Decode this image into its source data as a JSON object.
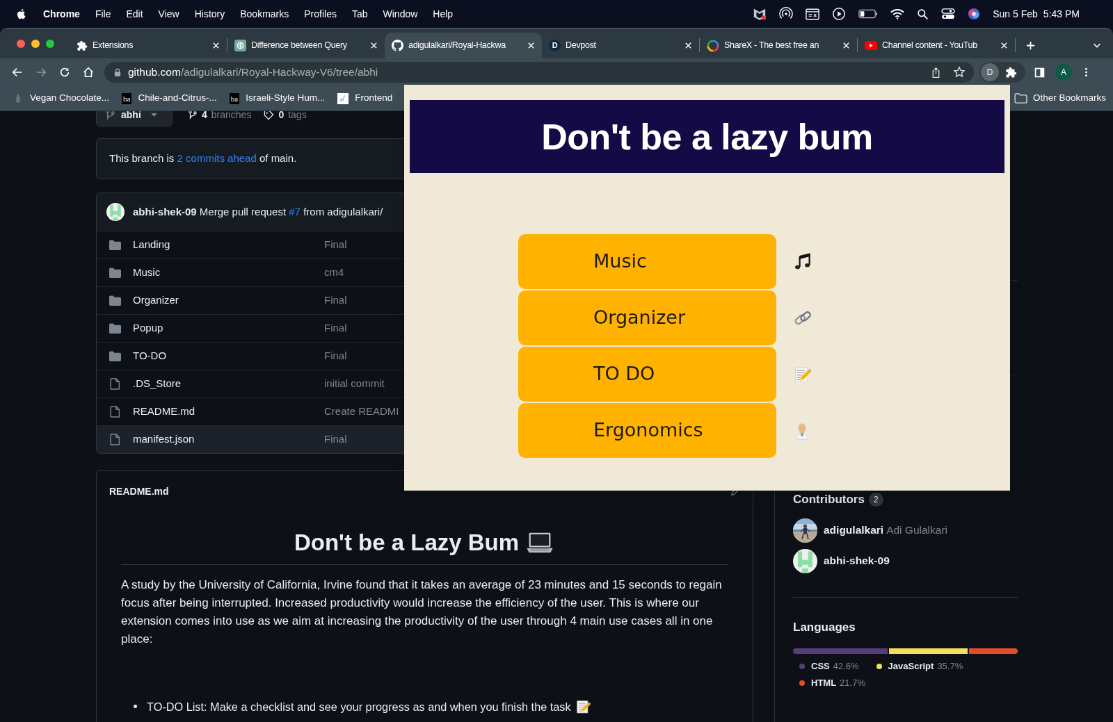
{
  "menu_bar": {
    "app": "Chrome",
    "menus": [
      "File",
      "Edit",
      "View",
      "History",
      "Bookmarks",
      "Profiles",
      "Tab",
      "Window",
      "Help"
    ],
    "date": "Sun 5 Feb",
    "time": "5:43 PM"
  },
  "tabs": [
    {
      "title": "Extensions",
      "kind": "puzzle",
      "selected": false
    },
    {
      "title": "Difference between Query",
      "kind": "openai",
      "selected": false
    },
    {
      "title": "adigulalkari/Royal-Hackwa",
      "kind": "github",
      "selected": true
    },
    {
      "title": "Devpost",
      "kind": "letter",
      "letter": "D",
      "selected": false
    },
    {
      "title": "ShareX - The best free an",
      "kind": "sharex",
      "selected": false
    },
    {
      "title": "Channel content - YouTub",
      "kind": "youtube",
      "selected": false
    }
  ],
  "address_bar": {
    "host": "github.com",
    "path": "/adigulalkari/Royal-Hackway-V6/tree/abhi"
  },
  "toolbar": {
    "profile_letter": "D",
    "account_letter": "A"
  },
  "bookmarks": [
    {
      "label": "Vegan Chocolate...",
      "kind": "bottle"
    },
    {
      "label": "Chile-and-Citrus-...",
      "kind": "text",
      "favicon_text": "ba"
    },
    {
      "label": "Israeli-Style Hum...",
      "kind": "text",
      "favicon_text": "ba"
    },
    {
      "label": "Frontend"
    }
  ],
  "other_bookmarks": "Other Bookmarks",
  "repo": {
    "branch": "abhi",
    "branches_count": "4",
    "branches_label": "branches",
    "tags_count": "0",
    "tags_label": "tags",
    "ahead_notice": {
      "before": "This branch is ",
      "link": "2 commits ahead",
      "after": " of main."
    },
    "latest_commit": {
      "author": "abhi-shek-09",
      "before": "Merge pull request ",
      "link": "#7",
      "after": " from adigulalkari/"
    },
    "files": [
      {
        "name": "Landing",
        "kind": "folder",
        "message": "Final",
        "hovered": false
      },
      {
        "name": "Music",
        "kind": "folder",
        "message": "cm4",
        "hovered": false
      },
      {
        "name": "Organizer",
        "kind": "folder",
        "message": "Final",
        "hovered": false
      },
      {
        "name": "Popup",
        "kind": "folder",
        "message": "Final",
        "hovered": false
      },
      {
        "name": "TO-DO",
        "kind": "folder",
        "message": "Final",
        "hovered": false
      },
      {
        "name": ".DS_Store",
        "kind": "file",
        "message": "initial commit",
        "hovered": false
      },
      {
        "name": "README.md",
        "kind": "file",
        "message": "Create READMI",
        "hovered": false
      },
      {
        "name": "manifest.json",
        "kind": "file",
        "message": "Final",
        "hovered": true
      }
    ],
    "readme": {
      "filename": "README.md",
      "heading": "Don't be a Lazy Bum",
      "paragraph": "A study by the University of California, Irvine found that it takes an average of 23 minutes and 15 seconds to regain focus after being interrupted. Increased productivity would increase the efficiency of the user. This is where our extension comes into use as we aim at increasing the productivity of the user through 4 main use cases all in one place:",
      "list": [
        "TO-DO List: Make a checklist and see your progress as and when you finish the task"
      ]
    }
  },
  "sidebar": {
    "contributors": {
      "title": "Contributors",
      "count": "2",
      "people": [
        {
          "login": "adigulalkari",
          "name": "Adi Gulalkari"
        },
        {
          "login": "abhi-shek-09",
          "kind": "identicon"
        }
      ]
    },
    "languages": {
      "title": "Languages",
      "items": [
        {
          "name": "CSS",
          "percent": "42.6%",
          "color": "#563d7c"
        },
        {
          "name": "JavaScript",
          "percent": "35.7%",
          "color": "#f1e05a"
        },
        {
          "name": "HTML",
          "percent": "21.7%",
          "color": "#e34c26"
        }
      ]
    }
  },
  "popup": {
    "title": "Don't be a lazy bum",
    "buttons": [
      {
        "label": "Music",
        "kind": "music"
      },
      {
        "label": "Organizer",
        "kind": "link"
      },
      {
        "label": "TO DO",
        "kind": "memo"
      },
      {
        "label": "Ergonomics",
        "kind": "worker"
      }
    ]
  }
}
